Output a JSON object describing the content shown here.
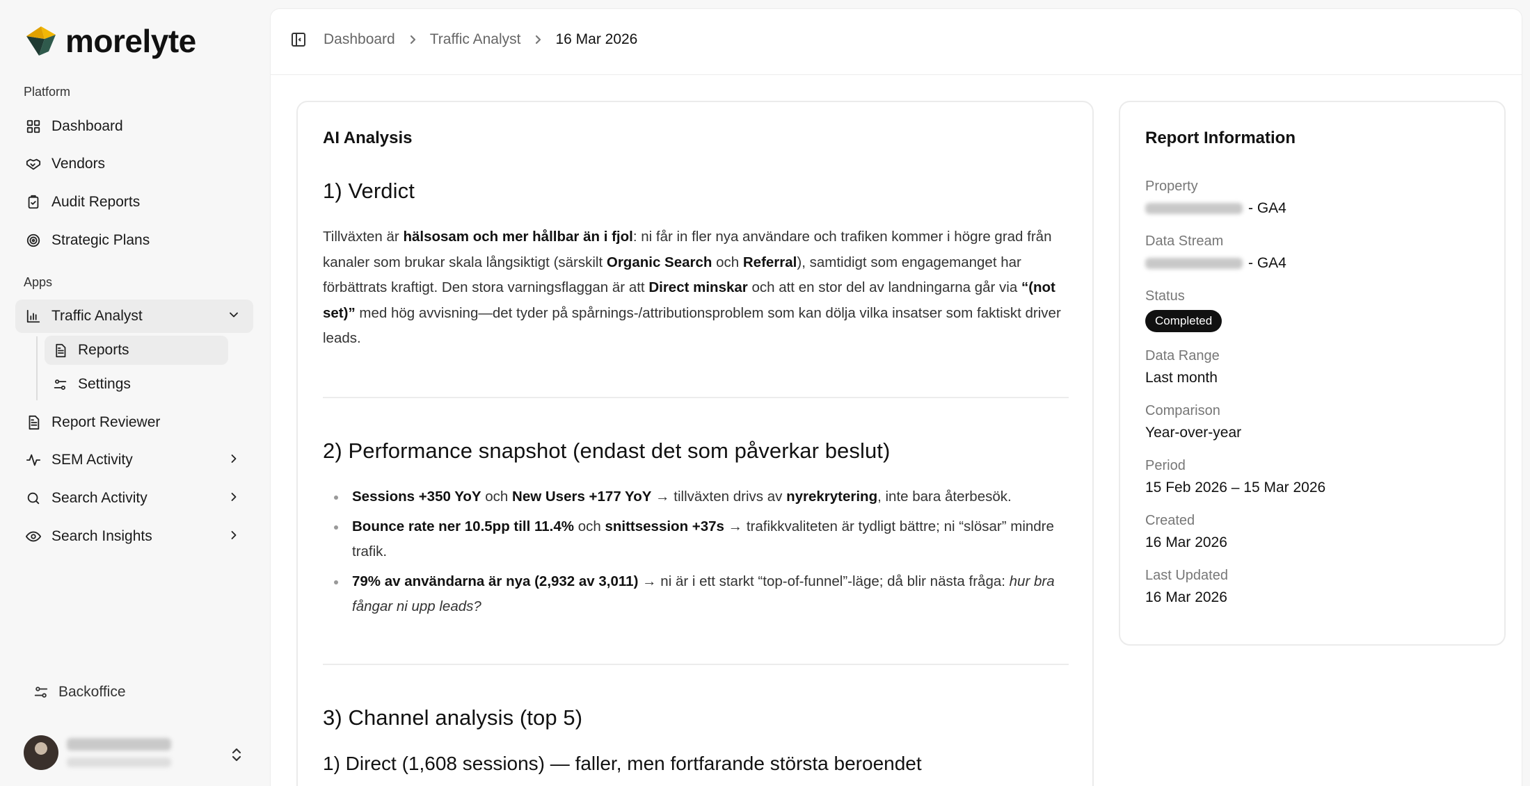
{
  "app": {
    "logo_text": "morelyte"
  },
  "sidebar": {
    "platform_label": "Platform",
    "apps_label": "Apps",
    "items": [
      {
        "label": "Dashboard"
      },
      {
        "label": "Vendors"
      },
      {
        "label": "Audit Reports"
      },
      {
        "label": "Strategic Plans"
      }
    ],
    "traffic_analyst": {
      "label": "Traffic Analyst",
      "children": [
        {
          "label": "Reports"
        },
        {
          "label": "Settings"
        }
      ]
    },
    "apps_items": [
      {
        "label": "Report Reviewer"
      },
      {
        "label": "SEM Activity"
      },
      {
        "label": "Search Activity"
      },
      {
        "label": "Search Insights"
      }
    ],
    "backoffice_label": "Backoffice"
  },
  "breadcrumb": {
    "items": [
      "Dashboard",
      "Traffic Analyst",
      "16 Mar 2026"
    ]
  },
  "analysis": {
    "title": "AI Analysis",
    "verdict_heading": "1) Verdict",
    "verdict": {
      "t1": "Tillväxten är ",
      "b1": "hälsosam och mer hållbar än i fjol",
      "t2": ": ni får in fler nya användare och trafiken kommer i högre grad från kanaler som brukar skala långsiktigt (särskilt ",
      "b2": "Organic Search",
      "t3": " och ",
      "b3": "Referral",
      "t4": "), samtidigt som engagemanget har förbättrats kraftigt. Den stora varningsflaggan är att ",
      "b4": "Direct minskar",
      "t5": " och att en stor del av landningarna går via ",
      "b5": "“(not set)”",
      "t6": " med hög avvisning—det tyder på spårnings-/attributionsproblem som kan dölja vilka insatser som faktiskt driver leads."
    },
    "snapshot_heading": "2) Performance snapshot (endast det som påverkar beslut)",
    "bullets": [
      {
        "b1": "Sessions +350 YoY",
        "t1": " och ",
        "b2": "New Users +177 YoY",
        "t2": " → tillväxten drivs av ",
        "b3": "nyrekrytering",
        "t3": ", inte bara återbesök."
      },
      {
        "b1": "Bounce rate ner 10.5pp till 11.4%",
        "t1": " och ",
        "b2": "snittsession +37s",
        "t2": " → trafikkvaliteten är tydligt bättre; ni “slösar” mindre trafik."
      },
      {
        "b1": "79% av användarna är nya (2,932 av 3,011)",
        "t1": " → ni är i ett starkt “top-of-funnel”-läge; då blir nästa fråga: ",
        "i1": "hur bra fångar ni upp leads?"
      }
    ],
    "channel_heading": "3) Channel analysis (top 5)",
    "channel_sub": "1) Direct (1,608 sessions) — faller, men fortfarande största beroendet"
  },
  "report_info": {
    "title": "Report Information",
    "property_label": "Property",
    "property_suffix": "- GA4",
    "stream_label": "Data Stream",
    "stream_suffix": "- GA4",
    "status_label": "Status",
    "status_value": "Completed",
    "range_label": "Data Range",
    "range_value": "Last month",
    "comparison_label": "Comparison",
    "comparison_value": "Year-over-year",
    "period_label": "Period",
    "period_value": "15 Feb 2026 – 15 Mar 2026",
    "created_label": "Created",
    "created_value": "16 Mar 2026",
    "updated_label": "Last Updated",
    "updated_value": "16 Mar 2026"
  },
  "colors": {
    "accent_logo_yellow": "#f2b705",
    "accent_logo_dark": "#1f3b33",
    "badge_bg": "#111111"
  }
}
